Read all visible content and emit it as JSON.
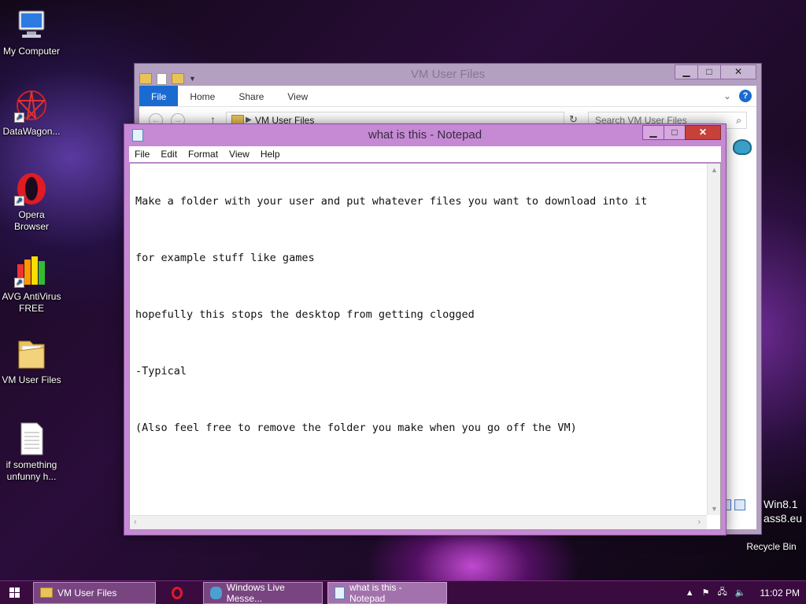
{
  "desktop": {
    "icons": [
      {
        "label": "My Computer"
      },
      {
        "label": "DataWagon..."
      },
      {
        "label": "Opera Browser"
      },
      {
        "label": "AVG AntiVirus FREE"
      },
      {
        "label": "VM User Files"
      },
      {
        "label": "if something unfunny h..."
      }
    ],
    "watermark_line1": "Win8.1",
    "watermark_line2": "ass8.eu",
    "recycle_bin": "Recycle Bin"
  },
  "explorer": {
    "title": "VM User Files",
    "tabs": [
      "File",
      "Home",
      "Share",
      "View"
    ],
    "address": "VM User Files",
    "search_placeholder": "Search VM User Files"
  },
  "notepad": {
    "title": "what is this - Notepad",
    "menu": [
      "File",
      "Edit",
      "Format",
      "View",
      "Help"
    ],
    "lines": [
      "Make a folder with your user and put whatever files you want to download into it",
      "for example stuff like games",
      "hopefully this stops the desktop from getting clogged",
      "-Typical",
      "(Also feel free to remove the folder you make when you go off the VM)"
    ]
  },
  "taskbar": {
    "items": [
      {
        "label": "VM User Files"
      },
      {
        "label": ""
      },
      {
        "label": "Windows Live Messe..."
      },
      {
        "label": "what is this - Notepad"
      }
    ],
    "clock": "11:02 PM"
  }
}
